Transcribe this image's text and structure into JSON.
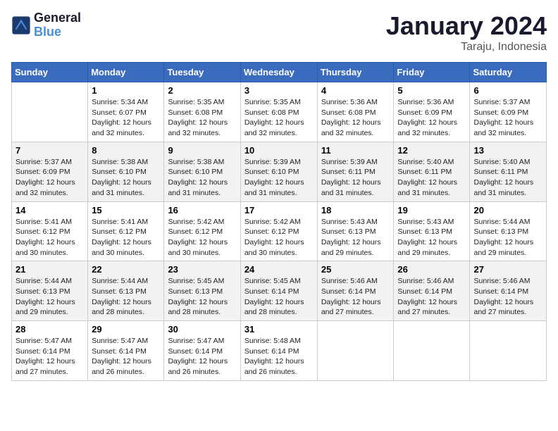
{
  "header": {
    "logo_line1": "General",
    "logo_line2": "Blue",
    "title": "January 2024",
    "subtitle": "Taraju, Indonesia"
  },
  "weekdays": [
    "Sunday",
    "Monday",
    "Tuesday",
    "Wednesday",
    "Thursday",
    "Friday",
    "Saturday"
  ],
  "weeks": [
    [
      {
        "day": "",
        "sunrise": "",
        "sunset": "",
        "daylight": ""
      },
      {
        "day": "1",
        "sunrise": "Sunrise: 5:34 AM",
        "sunset": "Sunset: 6:07 PM",
        "daylight": "Daylight: 12 hours and 32 minutes."
      },
      {
        "day": "2",
        "sunrise": "Sunrise: 5:35 AM",
        "sunset": "Sunset: 6:08 PM",
        "daylight": "Daylight: 12 hours and 32 minutes."
      },
      {
        "day": "3",
        "sunrise": "Sunrise: 5:35 AM",
        "sunset": "Sunset: 6:08 PM",
        "daylight": "Daylight: 12 hours and 32 minutes."
      },
      {
        "day": "4",
        "sunrise": "Sunrise: 5:36 AM",
        "sunset": "Sunset: 6:08 PM",
        "daylight": "Daylight: 12 hours and 32 minutes."
      },
      {
        "day": "5",
        "sunrise": "Sunrise: 5:36 AM",
        "sunset": "Sunset: 6:09 PM",
        "daylight": "Daylight: 12 hours and 32 minutes."
      },
      {
        "day": "6",
        "sunrise": "Sunrise: 5:37 AM",
        "sunset": "Sunset: 6:09 PM",
        "daylight": "Daylight: 12 hours and 32 minutes."
      }
    ],
    [
      {
        "day": "7",
        "sunrise": "Sunrise: 5:37 AM",
        "sunset": "Sunset: 6:09 PM",
        "daylight": "Daylight: 12 hours and 32 minutes."
      },
      {
        "day": "8",
        "sunrise": "Sunrise: 5:38 AM",
        "sunset": "Sunset: 6:10 PM",
        "daylight": "Daylight: 12 hours and 31 minutes."
      },
      {
        "day": "9",
        "sunrise": "Sunrise: 5:38 AM",
        "sunset": "Sunset: 6:10 PM",
        "daylight": "Daylight: 12 hours and 31 minutes."
      },
      {
        "day": "10",
        "sunrise": "Sunrise: 5:39 AM",
        "sunset": "Sunset: 6:10 PM",
        "daylight": "Daylight: 12 hours and 31 minutes."
      },
      {
        "day": "11",
        "sunrise": "Sunrise: 5:39 AM",
        "sunset": "Sunset: 6:11 PM",
        "daylight": "Daylight: 12 hours and 31 minutes."
      },
      {
        "day": "12",
        "sunrise": "Sunrise: 5:40 AM",
        "sunset": "Sunset: 6:11 PM",
        "daylight": "Daylight: 12 hours and 31 minutes."
      },
      {
        "day": "13",
        "sunrise": "Sunrise: 5:40 AM",
        "sunset": "Sunset: 6:11 PM",
        "daylight": "Daylight: 12 hours and 31 minutes."
      }
    ],
    [
      {
        "day": "14",
        "sunrise": "Sunrise: 5:41 AM",
        "sunset": "Sunset: 6:12 PM",
        "daylight": "Daylight: 12 hours and 30 minutes."
      },
      {
        "day": "15",
        "sunrise": "Sunrise: 5:41 AM",
        "sunset": "Sunset: 6:12 PM",
        "daylight": "Daylight: 12 hours and 30 minutes."
      },
      {
        "day": "16",
        "sunrise": "Sunrise: 5:42 AM",
        "sunset": "Sunset: 6:12 PM",
        "daylight": "Daylight: 12 hours and 30 minutes."
      },
      {
        "day": "17",
        "sunrise": "Sunrise: 5:42 AM",
        "sunset": "Sunset: 6:12 PM",
        "daylight": "Daylight: 12 hours and 30 minutes."
      },
      {
        "day": "18",
        "sunrise": "Sunrise: 5:43 AM",
        "sunset": "Sunset: 6:13 PM",
        "daylight": "Daylight: 12 hours and 29 minutes."
      },
      {
        "day": "19",
        "sunrise": "Sunrise: 5:43 AM",
        "sunset": "Sunset: 6:13 PM",
        "daylight": "Daylight: 12 hours and 29 minutes."
      },
      {
        "day": "20",
        "sunrise": "Sunrise: 5:44 AM",
        "sunset": "Sunset: 6:13 PM",
        "daylight": "Daylight: 12 hours and 29 minutes."
      }
    ],
    [
      {
        "day": "21",
        "sunrise": "Sunrise: 5:44 AM",
        "sunset": "Sunset: 6:13 PM",
        "daylight": "Daylight: 12 hours and 29 minutes."
      },
      {
        "day": "22",
        "sunrise": "Sunrise: 5:44 AM",
        "sunset": "Sunset: 6:13 PM",
        "daylight": "Daylight: 12 hours and 28 minutes."
      },
      {
        "day": "23",
        "sunrise": "Sunrise: 5:45 AM",
        "sunset": "Sunset: 6:13 PM",
        "daylight": "Daylight: 12 hours and 28 minutes."
      },
      {
        "day": "24",
        "sunrise": "Sunrise: 5:45 AM",
        "sunset": "Sunset: 6:14 PM",
        "daylight": "Daylight: 12 hours and 28 minutes."
      },
      {
        "day": "25",
        "sunrise": "Sunrise: 5:46 AM",
        "sunset": "Sunset: 6:14 PM",
        "daylight": "Daylight: 12 hours and 27 minutes."
      },
      {
        "day": "26",
        "sunrise": "Sunrise: 5:46 AM",
        "sunset": "Sunset: 6:14 PM",
        "daylight": "Daylight: 12 hours and 27 minutes."
      },
      {
        "day": "27",
        "sunrise": "Sunrise: 5:46 AM",
        "sunset": "Sunset: 6:14 PM",
        "daylight": "Daylight: 12 hours and 27 minutes."
      }
    ],
    [
      {
        "day": "28",
        "sunrise": "Sunrise: 5:47 AM",
        "sunset": "Sunset: 6:14 PM",
        "daylight": "Daylight: 12 hours and 27 minutes."
      },
      {
        "day": "29",
        "sunrise": "Sunrise: 5:47 AM",
        "sunset": "Sunset: 6:14 PM",
        "daylight": "Daylight: 12 hours and 26 minutes."
      },
      {
        "day": "30",
        "sunrise": "Sunrise: 5:47 AM",
        "sunset": "Sunset: 6:14 PM",
        "daylight": "Daylight: 12 hours and 26 minutes."
      },
      {
        "day": "31",
        "sunrise": "Sunrise: 5:48 AM",
        "sunset": "Sunset: 6:14 PM",
        "daylight": "Daylight: 12 hours and 26 minutes."
      },
      {
        "day": "",
        "sunrise": "",
        "sunset": "",
        "daylight": ""
      },
      {
        "day": "",
        "sunrise": "",
        "sunset": "",
        "daylight": ""
      },
      {
        "day": "",
        "sunrise": "",
        "sunset": "",
        "daylight": ""
      }
    ]
  ]
}
